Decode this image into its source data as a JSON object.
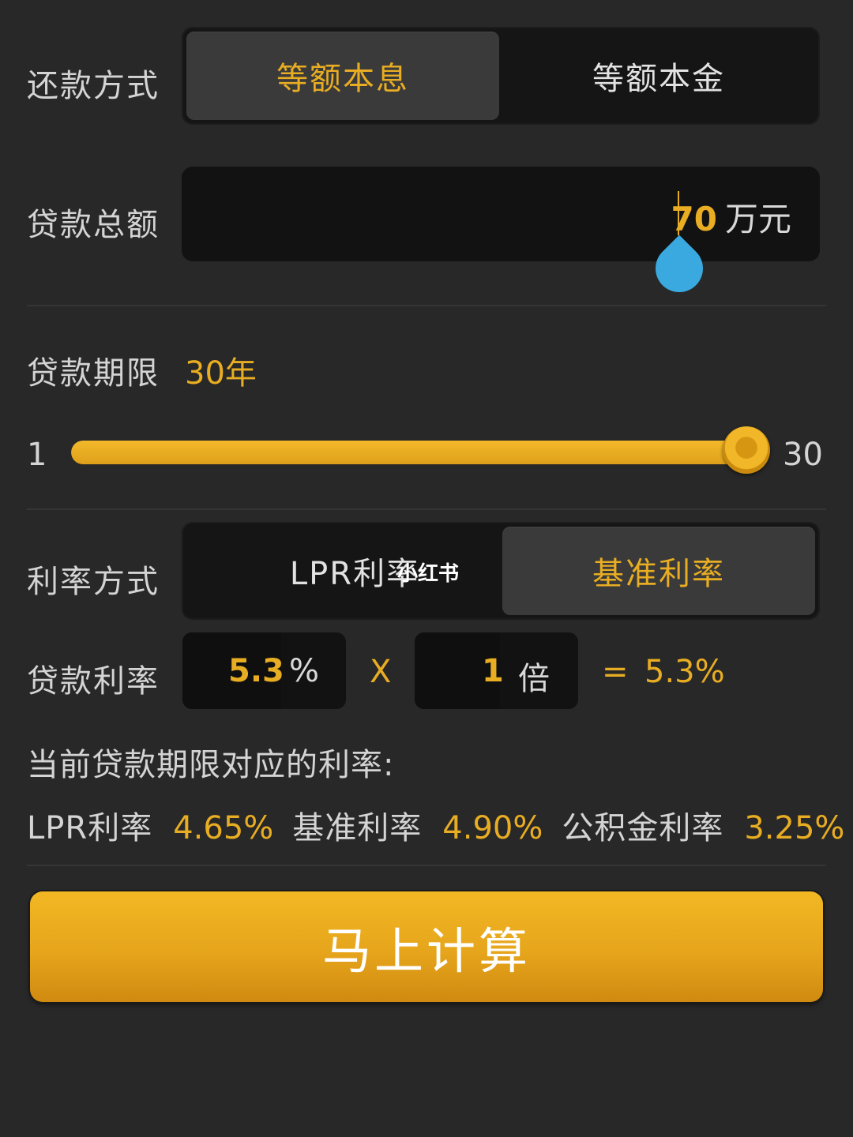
{
  "repayment": {
    "label": "还款方式",
    "options": [
      "等额本息",
      "等额本金"
    ],
    "selected": 0
  },
  "loan_amount": {
    "label": "贷款总额",
    "value": "70",
    "unit": "万元"
  },
  "loan_term": {
    "label": "贷款期限",
    "value": "30年",
    "slider_min": "1",
    "slider_max": "30",
    "slider_fraction": 1.0
  },
  "rate_type": {
    "label": "利率方式",
    "options": [
      "LPR利率",
      "基准利率"
    ],
    "selected": 1
  },
  "loan_rate": {
    "label": "贷款利率",
    "rate_value": "5.3",
    "rate_unit": "%",
    "times_symbol": "X",
    "multiplier_value": "1",
    "multiplier_unit": "倍",
    "equals_symbol": "=",
    "result": "5.3%"
  },
  "current_rates": {
    "title": "当前贷款期限对应的利率:",
    "items": [
      {
        "label": "LPR利率",
        "value": "4.65%"
      },
      {
        "label": "基准利率",
        "value": "4.90%"
      },
      {
        "label": "公积金利率",
        "value": "3.25%"
      }
    ]
  },
  "watermark": "小红书",
  "calculate_button": "马上计算",
  "colors": {
    "background": "#282828",
    "accent": "#e8ad22",
    "handle": "#3aa9e0"
  }
}
